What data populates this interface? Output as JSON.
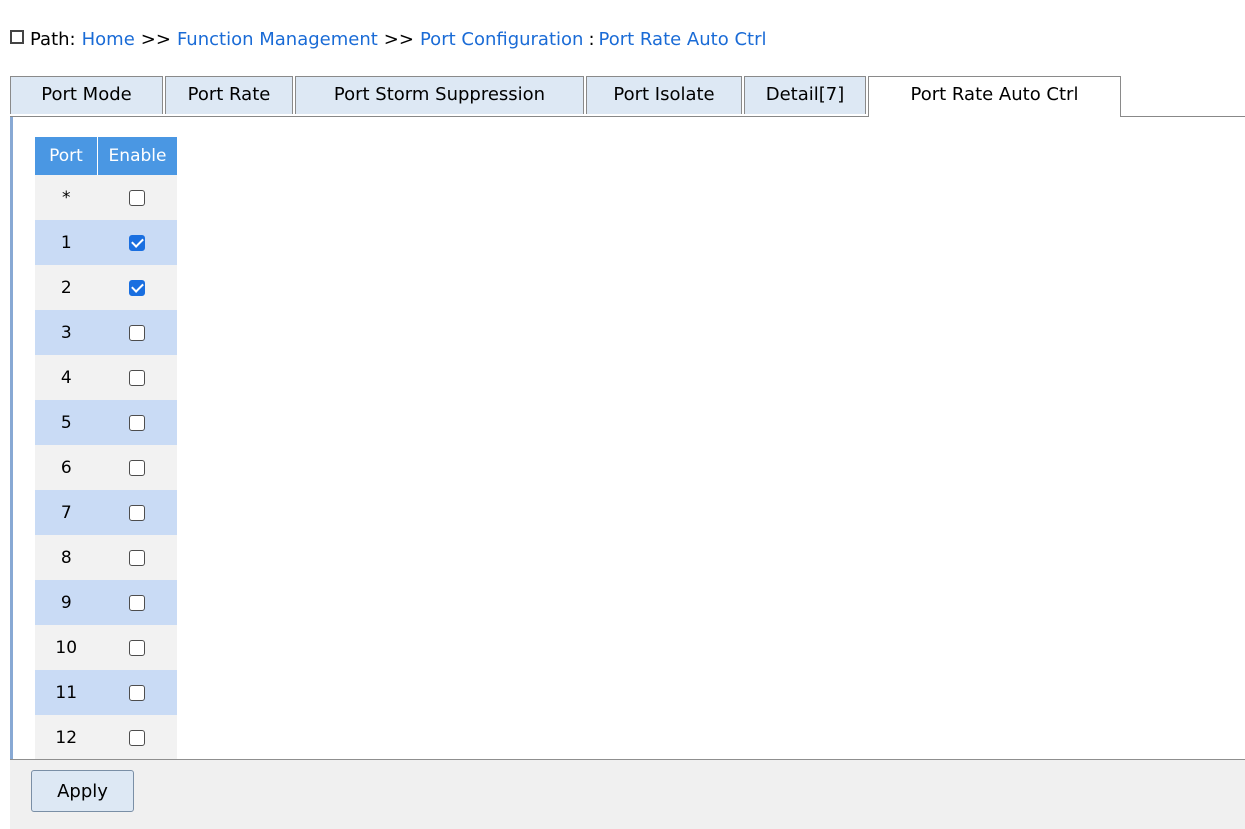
{
  "path": {
    "label": "Path:",
    "crumbs": [
      "Home",
      "Function Management",
      "Port Configuration"
    ],
    "separator": ">>",
    "current_sep": ":",
    "current": "Port Rate Auto Ctrl"
  },
  "tabs": [
    {
      "label": "Port Mode",
      "active": false
    },
    {
      "label": "Port Rate",
      "active": false
    },
    {
      "label": "Port Storm Suppression",
      "active": false
    },
    {
      "label": "Port Isolate",
      "active": false
    },
    {
      "label": "Detail[7]",
      "active": false
    },
    {
      "label": "Port Rate Auto Ctrl",
      "active": true
    }
  ],
  "table": {
    "headers": {
      "port": "Port",
      "enable": "Enable"
    },
    "rows": [
      {
        "port": "*",
        "enabled": false
      },
      {
        "port": "1",
        "enabled": true
      },
      {
        "port": "2",
        "enabled": true
      },
      {
        "port": "3",
        "enabled": false
      },
      {
        "port": "4",
        "enabled": false
      },
      {
        "port": "5",
        "enabled": false
      },
      {
        "port": "6",
        "enabled": false
      },
      {
        "port": "7",
        "enabled": false
      },
      {
        "port": "8",
        "enabled": false
      },
      {
        "port": "9",
        "enabled": false
      },
      {
        "port": "10",
        "enabled": false
      },
      {
        "port": "11",
        "enabled": false
      },
      {
        "port": "12",
        "enabled": false
      }
    ]
  },
  "footer": {
    "apply_label": "Apply"
  },
  "colors": {
    "header_bg": "#4a97e3",
    "row_even_bg": "#c9dbf5",
    "row_odd_bg": "#f2f2f2",
    "link": "#1a6bd6",
    "checkbox_checked": "#1a6fe0"
  }
}
